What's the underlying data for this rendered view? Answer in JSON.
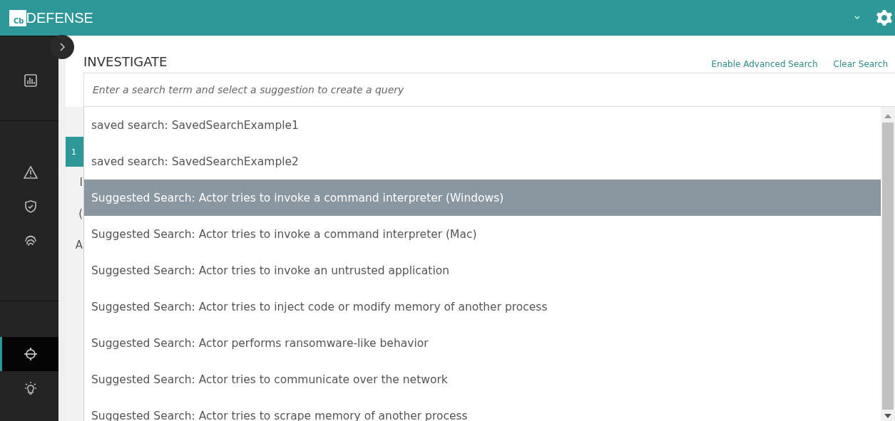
{
  "header": {
    "logo_mark": "Cb",
    "product": "DEFENSE"
  },
  "sidebar": {
    "items": [
      {
        "selected": false
      },
      {
        "selected": false
      },
      {
        "selected": false
      },
      {
        "selected": false
      },
      {
        "selected": true
      },
      {
        "selected": false
      }
    ]
  },
  "page": {
    "title": "INVESTIGATE",
    "links": [
      "Enable Advanced Search",
      "Clear Search"
    ]
  },
  "search": {
    "placeholder": "Enter a search term and select a suggestion to create a query"
  },
  "behind": {
    "tab": "1",
    "row_letters": [
      "I",
      "(",
      "A"
    ]
  },
  "suggestions": [
    {
      "label": "saved search: SavedSearchExample1",
      "selected": false
    },
    {
      "label": "saved search: SavedSearchExample2",
      "selected": false
    },
    {
      "label": "Suggested Search: Actor tries to invoke a command interpreter (Windows)",
      "selected": true
    },
    {
      "label": "Suggested Search: Actor tries to invoke a command interpreter (Mac)",
      "selected": false
    },
    {
      "label": "Suggested Search: Actor tries to invoke an untrusted application",
      "selected": false
    },
    {
      "label": "Suggested Search: Actor tries to inject code or modify memory of another process",
      "selected": false
    },
    {
      "label": "Suggested Search: Actor performs ransomware-like behavior",
      "selected": false
    },
    {
      "label": "Suggested Search: Actor tries to communicate over the network",
      "selected": false
    },
    {
      "label": "Suggested Search: Actor tries to scrape memory of another process",
      "selected": false
    }
  ]
}
